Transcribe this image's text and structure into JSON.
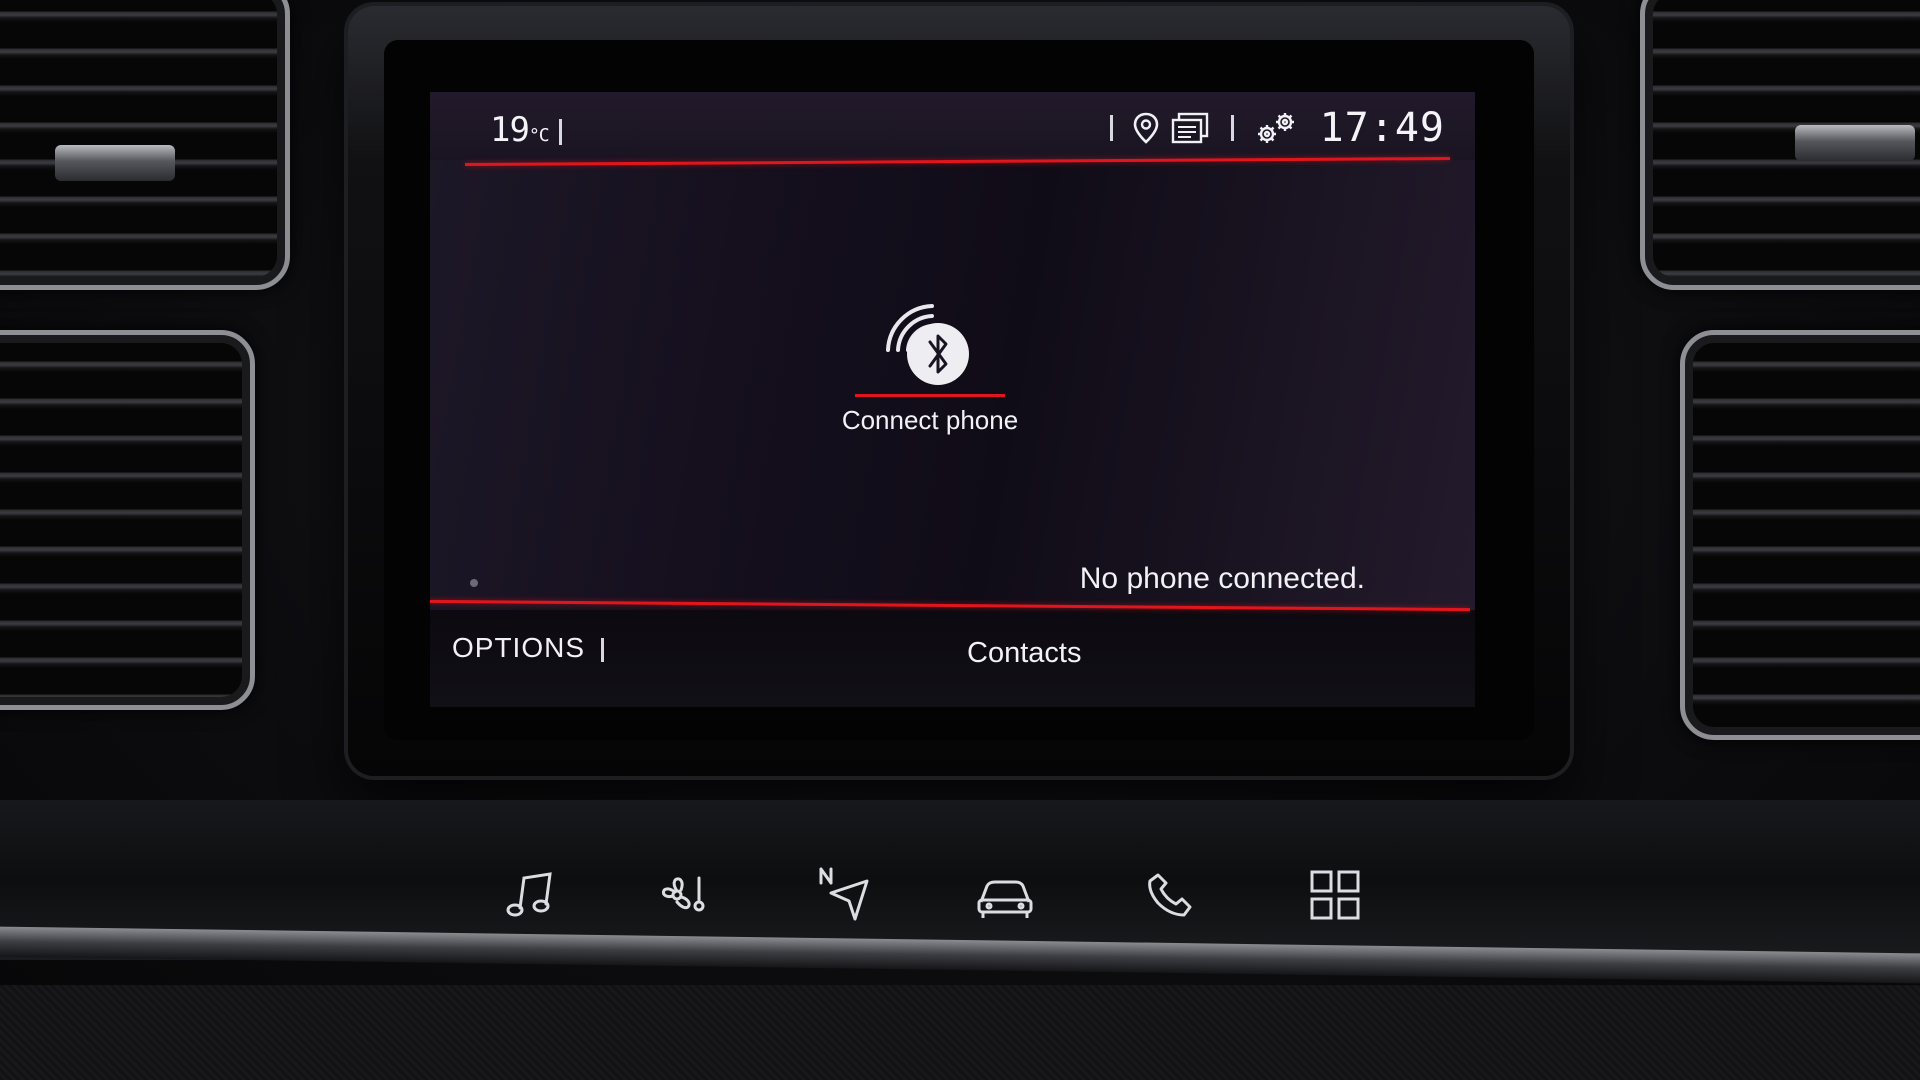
{
  "status_bar": {
    "temperature": "19",
    "temperature_unit": "°C",
    "time": "17:49",
    "icons": [
      "location-pin-icon",
      "media-source-icon",
      "settings-gears-icon"
    ]
  },
  "main": {
    "connect_label": "Connect phone",
    "connect_icon": "bluetooth-icon",
    "status_message": "No phone connected."
  },
  "bottom_bar": {
    "options_label": "OPTIONS",
    "contacts_label": "Contacts"
  },
  "hardware_buttons": [
    {
      "name": "music-button",
      "icon": "music-note-icon"
    },
    {
      "name": "climate-button",
      "icon": "fan-temperature-icon"
    },
    {
      "name": "navigation-button",
      "icon": "navigation-arrow-icon"
    },
    {
      "name": "vehicle-button",
      "icon": "car-icon"
    },
    {
      "name": "phone-button",
      "icon": "phone-handset-icon"
    },
    {
      "name": "apps-button",
      "icon": "grid-icon"
    }
  ],
  "colors": {
    "accent_red": "#e1161d",
    "screen_background": "#150f1e",
    "text": "#f2f2f6"
  }
}
